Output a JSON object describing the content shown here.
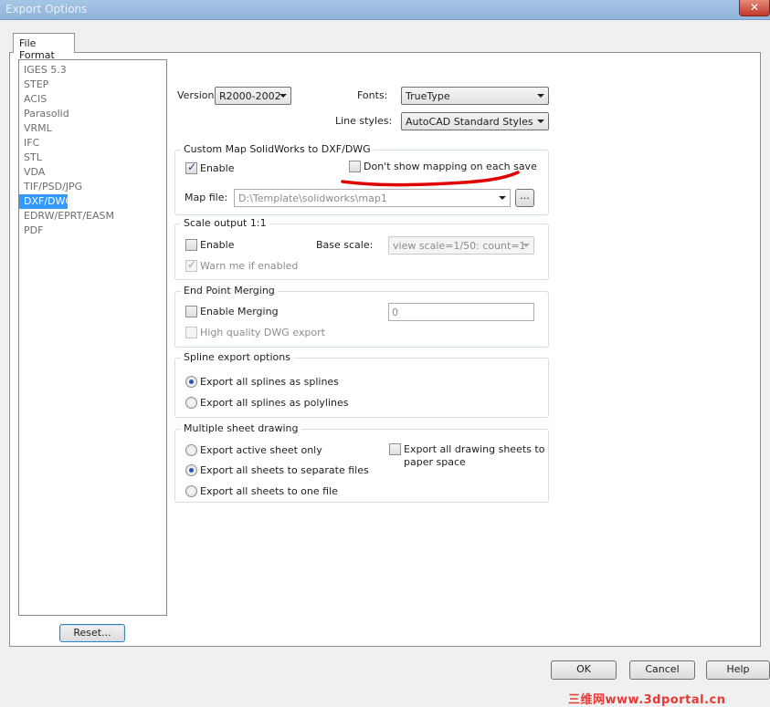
{
  "window": {
    "title": "Export Options",
    "close_symbol": "✕"
  },
  "tabs": [
    {
      "label": "File Format"
    }
  ],
  "format_list": {
    "items": [
      "IGES 5.3",
      "STEP",
      "ACIS",
      "Parasolid",
      "VRML",
      "IFC",
      "STL",
      "VDA",
      "TIF/PSD/JPG",
      "DXF/DWG",
      "EDRW/EPRT/EASM",
      "PDF"
    ],
    "selected": "DXF/DWG"
  },
  "reset_label": "Reset...",
  "version": {
    "label": "Version:",
    "value": "R2000-2002"
  },
  "fonts": {
    "label": "Fonts:",
    "value": "TrueType"
  },
  "line_styles": {
    "label": "Line styles:",
    "value": "AutoCAD Standard Styles"
  },
  "custom_map": {
    "title": "Custom Map SolidWorks to DXF/DWG",
    "enable_label": "Enable",
    "enable_checked": true,
    "dont_show_label": "Don't show mapping on each save",
    "dont_show_checked": false,
    "map_file_label": "Map file:",
    "map_file_value": "D:\\Template\\solidworks\\map1",
    "browse_label": "..."
  },
  "scale_output": {
    "title": "Scale output 1:1",
    "enable_label": "Enable",
    "enable_checked": false,
    "base_scale_label": "Base scale:",
    "base_scale_value": "view scale=1/50: count=1",
    "warn_label": "Warn me if enabled",
    "warn_checked": true
  },
  "end_point": {
    "title": "End Point Merging",
    "enable_label": "Enable Merging",
    "enable_checked": false,
    "value": "0",
    "high_quality_label": "High quality DWG export",
    "high_quality_checked": false
  },
  "spline": {
    "title": "Spline export options",
    "options": [
      "Export all splines as splines",
      "Export all splines as polylines"
    ],
    "selected_index": 0
  },
  "multi_sheet": {
    "title": "Multiple sheet drawing",
    "options": [
      "Export active sheet only",
      "Export all sheets to separate files",
      "Export all sheets to one file"
    ],
    "selected_index": 1,
    "paper_space_label_line1": "Export all drawing sheets to",
    "paper_space_label_line2": "paper space",
    "paper_space_checked": false
  },
  "buttons": {
    "ok": "OK",
    "cancel": "Cancel",
    "help": "Help"
  },
  "watermark": "三维网www.3dportal.cn",
  "colors": {
    "selection": "#3399ff",
    "annotation": "#e00000",
    "watermark": "#e53935"
  }
}
